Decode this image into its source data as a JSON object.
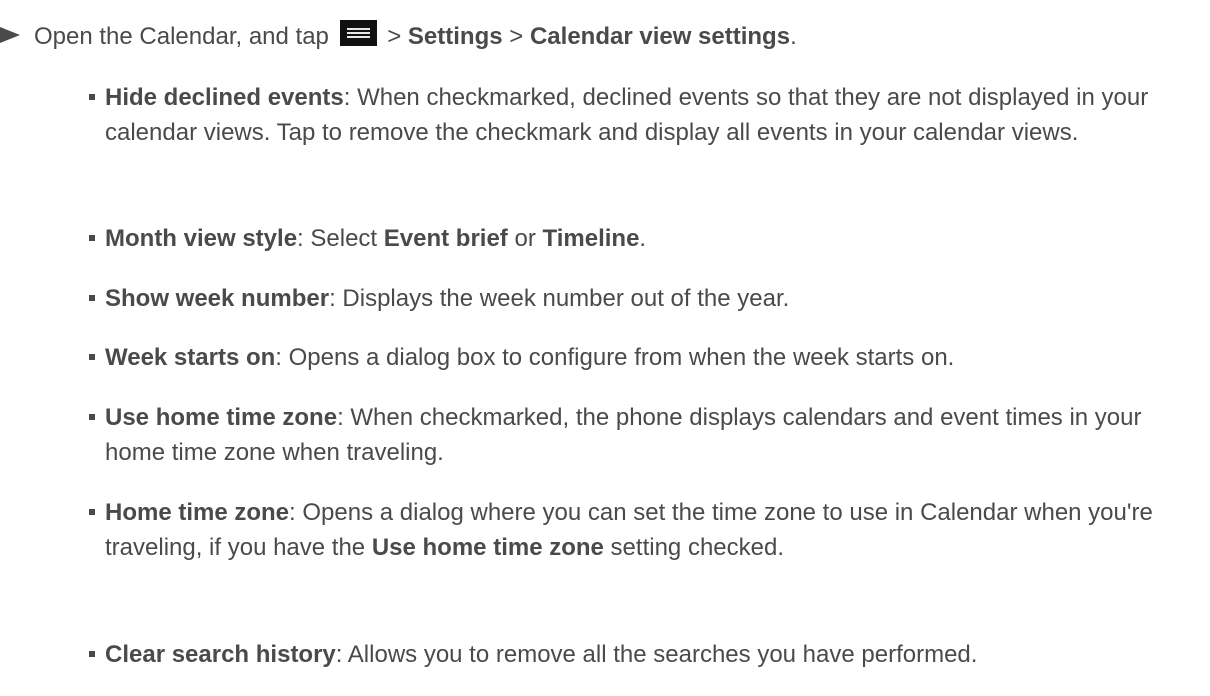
{
  "step": {
    "prefix": "Open the Calendar, and tap",
    "menu_icon": "menu-icon",
    "sep1": " > ",
    "settings": "Settings",
    "sep2": " > ",
    "calendar_view_settings": "Calendar view settings",
    "end": "."
  },
  "items": [
    {
      "term": "Hide declined events",
      "desc": ": When checkmarked, declined events so that they are not displayed in your calendar views. Tap to remove the checkmark and display all events in your calendar views."
    },
    {
      "term": "Month view style",
      "desc_a": ": Select ",
      "opt1": "Event brief",
      "desc_b": " or ",
      "opt2": "Timeline",
      "desc_c": "."
    },
    {
      "term": "Show week number",
      "desc": ": Displays the week number out of the year."
    },
    {
      "term": "Week starts on",
      "desc": ": Opens a dialog box to configure from when the week starts on."
    },
    {
      "term": "Use home time zone",
      "desc": ": When checkmarked, the phone displays calendars and event times in your home time zone when traveling."
    },
    {
      "term": "Home time zone",
      "desc_a": ": Opens a dialog where you can set the time zone to use in Calendar when you're traveling, if you have the ",
      "ref": "Use home time zone",
      "desc_b": " setting checked."
    },
    {
      "term": "Clear search history",
      "desc": ": Allows you to remove all the searches you have performed."
    }
  ]
}
